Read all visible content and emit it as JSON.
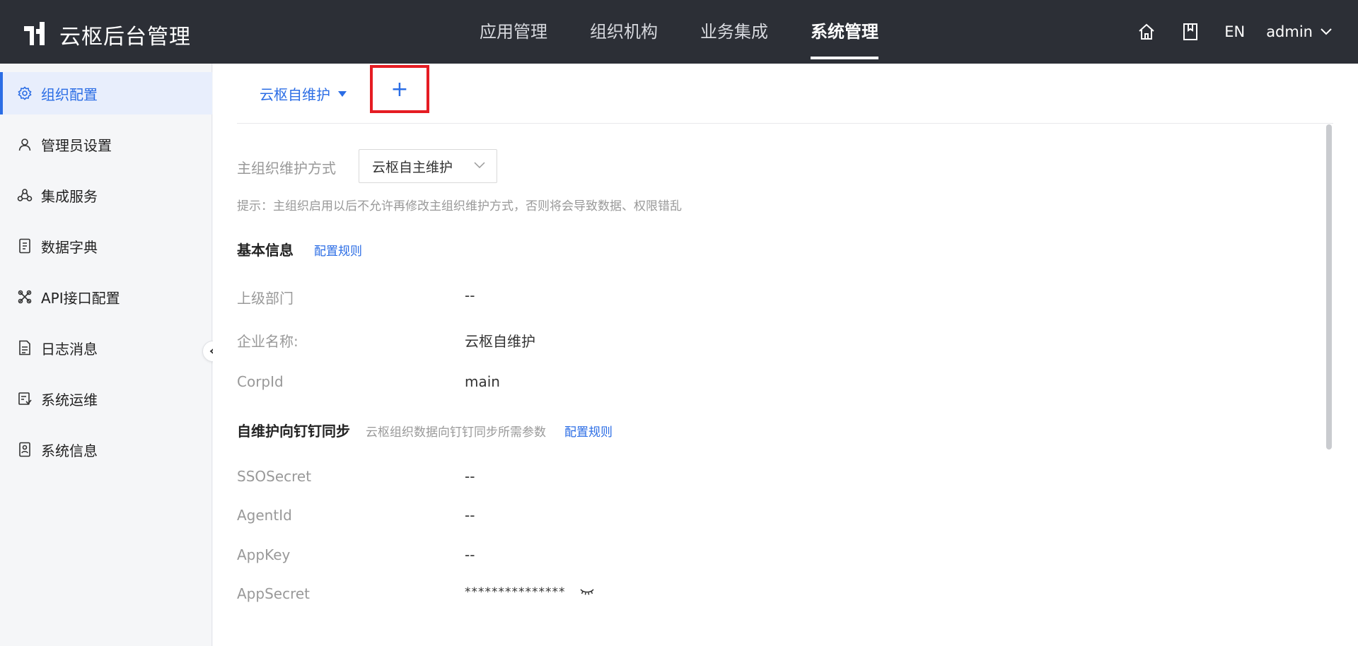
{
  "header": {
    "app_title": "云枢后台管理",
    "nav": [
      {
        "label": "应用管理"
      },
      {
        "label": "组织机构"
      },
      {
        "label": "业务集成"
      },
      {
        "label": "系统管理"
      }
    ],
    "lang": "EN",
    "user": "admin"
  },
  "sidebar": {
    "items": [
      {
        "label": "组织配置",
        "icon": "gear-icon"
      },
      {
        "label": "管理员设置",
        "icon": "user-icon"
      },
      {
        "label": "集成服务",
        "icon": "integration-icon"
      },
      {
        "label": "数据字典",
        "icon": "dictionary-icon"
      },
      {
        "label": "API接口配置",
        "icon": "api-icon"
      },
      {
        "label": "日志消息",
        "icon": "log-icon"
      },
      {
        "label": "系统运维",
        "icon": "maintenance-icon"
      },
      {
        "label": "系统信息",
        "icon": "info-icon"
      }
    ]
  },
  "tabs": {
    "current": "云枢自维护",
    "add_label": "+"
  },
  "form": {
    "maintenance_label": "主组织维护方式",
    "maintenance_value": "云枢自主维护",
    "hint": "提示：主组织启用以后不允许再修改主组织维护方式，否则将会导致数据、权限错乱",
    "basic_title": "基本信息",
    "config_rule": "配置规则",
    "fields_basic": [
      {
        "label": "上级部门",
        "value": "--"
      },
      {
        "label": "企业名称:",
        "value": "云枢自维护"
      },
      {
        "label": "CorpId",
        "value": "main"
      }
    ],
    "sync_title": "自维护向钉钉同步",
    "sync_desc": "云枢组织数据向钉钉同步所需参数",
    "sync_config_rule": "配置规则",
    "fields_sync": [
      {
        "label": "SSOSecret",
        "value": "--"
      },
      {
        "label": "AgentId",
        "value": "--"
      },
      {
        "label": "AppKey",
        "value": "--"
      },
      {
        "label": "AppSecret",
        "value": "***************"
      }
    ]
  },
  "colors": {
    "header_bg": "#2c2f36",
    "accent": "#2b6de5",
    "highlight_box": "#e51c23"
  }
}
